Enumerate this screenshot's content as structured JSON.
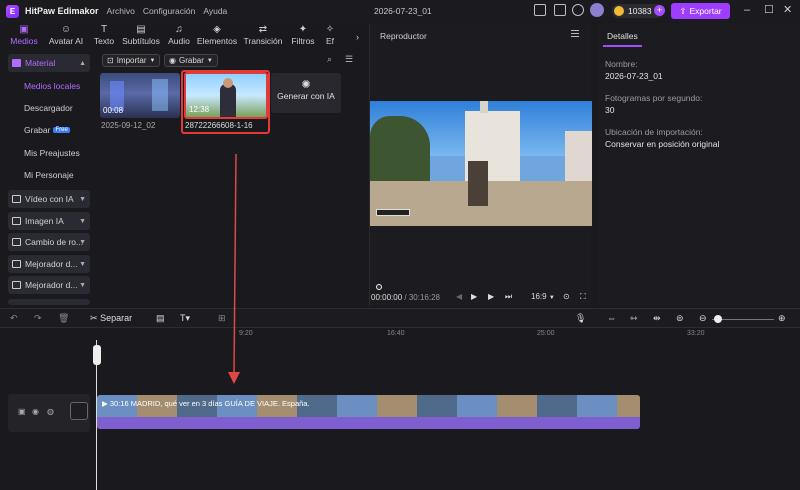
{
  "app": {
    "name": "HitPaw Edimakor",
    "menu": [
      "Archivo",
      "Configuración",
      "Ayuda"
    ],
    "project_title": "2026-07-23_01",
    "coins": "10383",
    "export_label": "Exportar"
  },
  "media_tabs": [
    "Medios",
    "Avatar AI",
    "Texto",
    "Subtítulos",
    "Audio",
    "Elementos",
    "Transición",
    "Filtros",
    "Ef"
  ],
  "sidebar": {
    "material": "Material",
    "sub_items": [
      "Medios locales",
      "Descargador",
      "Grabar",
      "Mis Preajustes",
      "Mi Personaje"
    ],
    "free_badge": "Free",
    "groups": [
      "Vídeo con IA",
      "Imagen IA",
      "Cambio de ro...",
      "Mejorador d...",
      "Mejorador d..."
    ]
  },
  "media_toolbar": {
    "import_label": "Importar",
    "record_label": "Grabar"
  },
  "media_items": [
    {
      "duration": "00:08",
      "label": "2025-09-12_02"
    },
    {
      "duration": "12:38",
      "label": "28722266608-1-16"
    }
  ],
  "generate_ia": "Generar con IA",
  "player": {
    "title": "Reproductor",
    "current_time": "00:00:00",
    "total_time": "30:16:28",
    "aspect": "16:9"
  },
  "details": {
    "tab": "Detalles",
    "name_label": "Nombre:",
    "name_value": "2026-07-23_01",
    "fps_label": "Fotogramas por segundo:",
    "fps_value": "30",
    "import_label": "Ubicación de importación:",
    "import_value": "Conservar en posición original"
  },
  "timeline": {
    "split_label": "Separar",
    "ticks": [
      "9:20",
      "16:40",
      "25:00",
      "33:20"
    ],
    "clip_title": "30:16 MADRID, qué ver en 3 días GUÍA DE VIAJE. España."
  },
  "colors": {
    "accent": "#a64cff",
    "highlight_border": "#e03a3a",
    "arrow": "#e04848"
  }
}
